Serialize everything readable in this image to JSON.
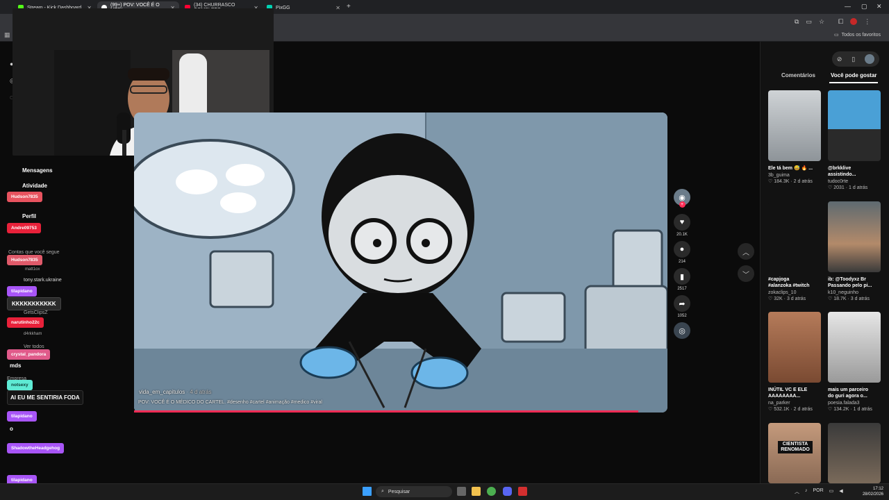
{
  "browser": {
    "tabs": [
      {
        "label": "Stream - Kick Dashboard",
        "color": "#53fc18"
      },
      {
        "label": "(99+) POV: VOCÊ É O MÉDI...",
        "color": "#ffffff"
      },
      {
        "label": "(34) CHURRASCO COMPLETO...",
        "color": "#ff0033"
      },
      {
        "label": "PixGG",
        "color": "#00d1b2"
      }
    ],
    "favorites_label": "Todos os favoritos"
  },
  "sidebar": {
    "items": [
      "Mensagens",
      "Atividade",
      "Perfil"
    ],
    "following_header": "Contas que você segue",
    "accounts": [
      "matt1ox",
      "tony.stark.ukraine",
      "GetsClipsZ",
      "d4rkkham"
    ],
    "see_all": "Ver todos",
    "company": "Empresa"
  },
  "chat": [
    {
      "user": "Hudson7835",
      "color": "#e8535f"
    },
    {
      "user": "Andre09753",
      "color": "#e8213a"
    },
    {
      "user": "Hudson7835",
      "color": "#e05a6a"
    },
    {
      "user": "tilapidano",
      "color": "#a855f7"
    },
    {
      "user": "KKKKKKKKKKK",
      "color": "#2b2b2b"
    },
    {
      "user": "narutinho22c",
      "color": "#e8213a"
    },
    {
      "user": "crystal_pandora",
      "color": "#e05a8a"
    },
    {
      "user": "mds",
      "color": ""
    },
    {
      "user": "notsexy",
      "color": "#5eead4"
    },
    {
      "user": "AI EU ME SENTIRIA FODA",
      "color": "#151515"
    },
    {
      "user": "tilapidano",
      "color": "#a855f7"
    },
    {
      "user": "o",
      "color": ""
    },
    {
      "user": "ShadowtheHeadgehog",
      "color": "#a855f7"
    },
    {
      "user": "tilapidano",
      "color": "#a855f7"
    }
  ],
  "video": {
    "author": "vida_em_capitulos",
    "age": "· 4 d atrás",
    "description": "POV: VOCÊ É O MÉDICO DO CARTEL. #desenho #cartel #animação #medico #viral",
    "progress": 0.945
  },
  "actions": {
    "likes": "20.1K",
    "comments": "214",
    "saves": "2517",
    "shares": "1052"
  },
  "right_panel": {
    "tabs": [
      "Comentários",
      "Você pode gostar"
    ],
    "active_tab": "Você pode gostar",
    "cards": [
      {
        "title": "Ele tá bem 😅 🔥 ...",
        "user": "3b_guima",
        "likes": "184.3K",
        "age": "2 d atrás"
      },
      {
        "title": "@brkklive\nassistindo...",
        "user": "tudoc0rte",
        "likes": "2031",
        "age": "1 d atrás"
      },
      {
        "title": "#capjoga\n#alanzoka #twitch",
        "user": "zokaclips_10",
        "likes": "32K",
        "age": "3 d atrás"
      },
      {
        "title": "ib: @Toodyxz Br\nPassando pelo pi...",
        "user": "k10_neguinho",
        "likes": "18.7K",
        "age": "3 d atrás"
      },
      {
        "title": "INÚTIL VC E ELE\nAAAAAAAA...",
        "user": "na_parker",
        "likes": "532.1K",
        "age": "2 d atrás"
      },
      {
        "title": "mais um parceiro\ndo guri agora o...",
        "user": "poesia.falada3",
        "likes": "134.2K",
        "age": "1 d atrás"
      }
    ],
    "thumb_text": "CIENTISTA\nRENOMADO"
  },
  "taskbar": {
    "search_placeholder": "Pesquisar",
    "lang": "POR",
    "time": "17:12",
    "date": "28/02/2026"
  }
}
